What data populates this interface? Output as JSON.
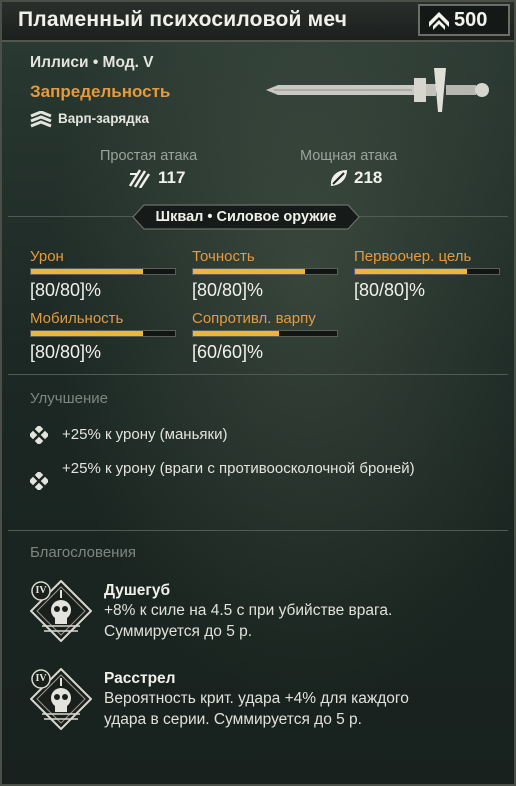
{
  "header": {
    "title": "Пламенный психосиловой меч",
    "rating": "500"
  },
  "item": {
    "subtitle": "Иллиси • Мод. V",
    "rarity": "Запредельность",
    "perk": "Варп-зарядка"
  },
  "attacks": {
    "light_label": "Простая атака",
    "light_value": "117",
    "heavy_label": "Мощная атака",
    "heavy_value": "218"
  },
  "tag": "Шквал • Силовое оружие",
  "stats": [
    {
      "label": "Урон",
      "value": "[80/80]%",
      "fill": 0.78
    },
    {
      "label": "Точность",
      "value": "[80/80]%",
      "fill": 0.78
    },
    {
      "label": "Первоочер. цель",
      "value": "[80/80]%",
      "fill": 0.78
    },
    {
      "label": "Мобильность",
      "value": "[80/80]%",
      "fill": 0.78
    },
    {
      "label": "Сопротивл. варпу",
      "value": "[60/60]%",
      "fill": 0.6
    }
  ],
  "improvement": {
    "title": "Улучшение",
    "items": [
      "+25% к урону (маньяки)",
      "+25% к урону (враги с противоосколочной броней)"
    ]
  },
  "blessings": {
    "title": "Благословения",
    "items": [
      {
        "tier": "IV",
        "name": "Душегуб",
        "desc": "+8% к силе на 4.5 с при убийстве врага. Суммируется до 5 р."
      },
      {
        "tier": "IV",
        "name": "Расстрел",
        "desc": "Вероятность крит. удара +4% для каждого удара в серии. Суммируется до 5 р."
      }
    ]
  },
  "colors": {
    "accent": "#e69a3c",
    "bar": "#f0b43c",
    "text": "#f1f1ec"
  }
}
